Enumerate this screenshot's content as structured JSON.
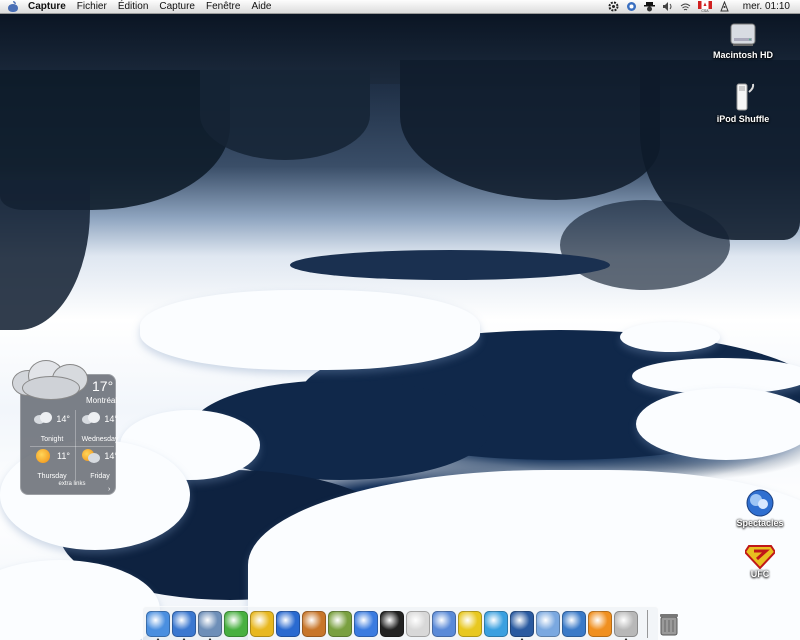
{
  "menubar": {
    "app_name": "Capture",
    "menus": [
      "Fichier",
      "Édition",
      "Capture",
      "Fenêtre",
      "Aide"
    ],
    "clock": "mer. 01:10",
    "status_icons": [
      "gear-icon",
      "camera-icon",
      "spy-icon",
      "volume-icon",
      "wifi-icon",
      "canada-flag-icon",
      "airport-icon"
    ]
  },
  "desktop_icons": [
    {
      "label": "Macintosh HD",
      "icon": "hard-drive-icon"
    },
    {
      "label": "iPod Shuffle",
      "icon": "ipod-shuffle-icon"
    },
    {
      "label": "Spectacles",
      "icon": "spectacles-icon"
    },
    {
      "label": "UFC",
      "icon": "superman-icon"
    }
  ],
  "weather": {
    "current_temp": "17°",
    "city": "Montréal",
    "forecast": [
      {
        "day": "Tonight",
        "temp": "14°",
        "icon": "cloud-icon"
      },
      {
        "day": "Wednesday",
        "temp": "14°",
        "icon": "cloud-icon"
      },
      {
        "day": "Thursday",
        "temp": "11°",
        "icon": "sun-icon"
      },
      {
        "day": "Friday",
        "temp": "14°",
        "icon": "sun-cloud-icon"
      }
    ],
    "footer": "extra links",
    "footer_arrow": "›"
  },
  "dock": {
    "apps": [
      {
        "name": "finder-icon",
        "color": "#4a8fe0"
      },
      {
        "name": "safari-icon",
        "color": "#3b78d0"
      },
      {
        "name": "preview-icon",
        "color": "#6e8fb8"
      },
      {
        "name": "itunes-icon",
        "color": "#48b040"
      },
      {
        "name": "road-sign-icon",
        "color": "#e8b820"
      },
      {
        "name": "imovie-icon",
        "color": "#2a6ad0"
      },
      {
        "name": "iphoto-icon",
        "color": "#c8762a"
      },
      {
        "name": "eye-icon",
        "color": "#7aa040"
      },
      {
        "name": "quicktime-icon",
        "color": "#3a7be0"
      },
      {
        "name": "clapper-icon",
        "color": "#222222"
      },
      {
        "name": "apple-icon",
        "color": "#d8d8d8"
      },
      {
        "name": "search-icon",
        "color": "#5a8ad8"
      },
      {
        "name": "messenger-icon",
        "color": "#e8c820"
      },
      {
        "name": "buddies-icon",
        "color": "#3aa0e0"
      },
      {
        "name": "mail-stamp-icon",
        "color": "#2a5aa0"
      },
      {
        "name": "hh-icon",
        "color": "#7aa8e0"
      },
      {
        "name": "w-icon",
        "color": "#3a7ac8"
      },
      {
        "name": "t-icon",
        "color": "#f09020"
      },
      {
        "name": "tools-icon",
        "color": "#b8b8b8"
      }
    ],
    "trash": {
      "name": "trash-icon",
      "color": "#8a8a8a"
    }
  }
}
